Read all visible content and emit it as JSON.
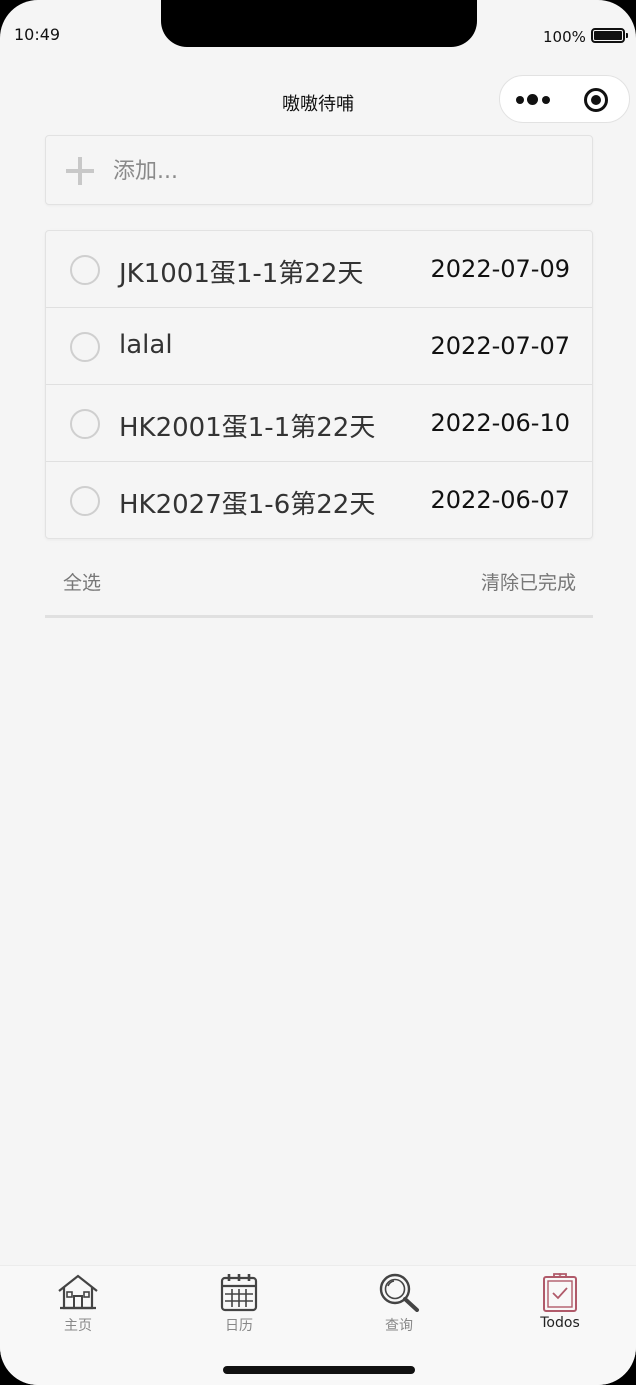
{
  "status": {
    "time": "10:49",
    "battery": "100%"
  },
  "nav": {
    "title": "嗷嗷待哺"
  },
  "add": {
    "placeholder": "添加..."
  },
  "todos": [
    {
      "text": "JK1001蛋1-1第22天",
      "date": "2022-07-09",
      "done": false
    },
    {
      "text": "lalal",
      "date": "2022-07-07",
      "done": false
    },
    {
      "text": "HK2001蛋1-1第22天",
      "date": "2022-06-10",
      "done": false
    },
    {
      "text": "HK2027蛋1-6第22天",
      "date": "2022-06-07",
      "done": false
    }
  ],
  "footer": {
    "select_all": "全选",
    "clear_done": "清除已完成"
  },
  "tabbar": {
    "items": [
      {
        "label": "主页",
        "icon": "home-icon",
        "active": false
      },
      {
        "label": "日历",
        "icon": "calendar-icon",
        "active": false
      },
      {
        "label": "查询",
        "icon": "search-icon",
        "active": false
      },
      {
        "label": "Todos",
        "icon": "clipboard-icon",
        "active": true
      }
    ],
    "active_color": "#b05a6a",
    "inactive_color": "#555555"
  }
}
